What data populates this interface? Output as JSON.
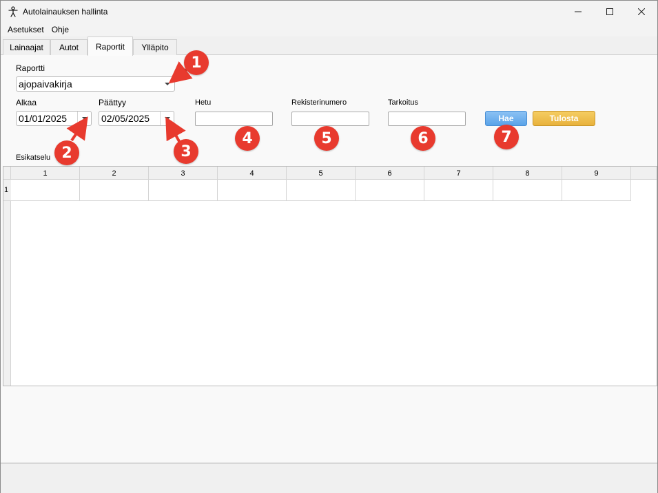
{
  "window": {
    "title": "Autolainauksen hallinta",
    "icon": "accessibility-person-icon",
    "controls": [
      "minimize-icon",
      "maximize-icon",
      "close-icon"
    ]
  },
  "menu": {
    "items": [
      {
        "label": "Asetukset"
      },
      {
        "label": "Ohje"
      }
    ]
  },
  "tabs": [
    {
      "label": "Lainaajat",
      "active": false
    },
    {
      "label": "Autot",
      "active": false
    },
    {
      "label": "Raportit",
      "active": true
    },
    {
      "label": "Ylläpito",
      "active": false
    }
  ],
  "form": {
    "report_label": "Raportti",
    "report_value": "ajopaivakirja",
    "start_label": "Alkaa",
    "start_value": "01/01/2025",
    "end_label": "Päättyy",
    "end_value": "02/05/2025",
    "hetu_label": "Hetu",
    "hetu_value": "",
    "reg_label": "Rekisterinumero",
    "reg_value": "",
    "purpose_label": "Tarkoitus",
    "purpose_value": "",
    "search_button": "Hae",
    "print_button": "Tulosta",
    "preview_label": "Esikatselu"
  },
  "grid": {
    "columns": [
      "1",
      "2",
      "3",
      "4",
      "5",
      "6",
      "7",
      "8",
      "9"
    ],
    "rows": [
      {
        "header": "1",
        "cells": [
          "",
          "",
          "",
          "",
          "",
          "",
          "",
          "",
          ""
        ]
      }
    ]
  },
  "annotations": {
    "badges": [
      "1",
      "2",
      "3",
      "4",
      "5",
      "6",
      "7"
    ],
    "color": "#e83a2e"
  },
  "colors": {
    "search_button": "#6aaef0",
    "print_button": "#efc04e"
  }
}
